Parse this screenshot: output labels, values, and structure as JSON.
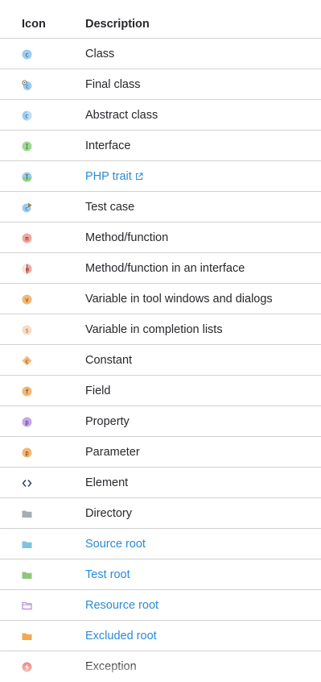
{
  "header": {
    "icon": "Icon",
    "description": "Description"
  },
  "rows": [
    {
      "icon": "class-icon",
      "text": "Class",
      "link": false
    },
    {
      "icon": "final-class-icon",
      "text": "Final class",
      "link": false
    },
    {
      "icon": "abstract-class-icon",
      "text": "Abstract class",
      "link": false
    },
    {
      "icon": "interface-icon",
      "text": "Interface",
      "link": false
    },
    {
      "icon": "php-trait-icon",
      "text": "PHP trait",
      "link": true
    },
    {
      "icon": "test-case-icon",
      "text": "Test case",
      "link": false
    },
    {
      "icon": "method-icon",
      "text": "Method/function",
      "link": false
    },
    {
      "icon": "interface-method-icon",
      "text": "Method/function in an interface",
      "link": false
    },
    {
      "icon": "variable-icon",
      "text": "Variable in tool windows and dialogs",
      "link": false
    },
    {
      "icon": "completion-variable-icon",
      "text": "Variable in completion lists",
      "link": false
    },
    {
      "icon": "constant-icon",
      "text": "Constant",
      "link": false
    },
    {
      "icon": "field-icon",
      "text": "Field",
      "link": false
    },
    {
      "icon": "property-icon",
      "text": "Property",
      "link": false
    },
    {
      "icon": "parameter-icon",
      "text": "Parameter",
      "link": false
    },
    {
      "icon": "element-icon",
      "text": "Element",
      "link": false
    },
    {
      "icon": "directory-icon",
      "text": "Directory",
      "link": false
    },
    {
      "icon": "source-root-icon",
      "text": "Source root",
      "link": true
    },
    {
      "icon": "test-root-icon",
      "text": "Test root",
      "link": true
    },
    {
      "icon": "resource-root-icon",
      "text": "Resource root",
      "link": true
    },
    {
      "icon": "excluded-root-icon",
      "text": "Excluded root",
      "link": true
    },
    {
      "icon": "exception-icon",
      "text": "Exception",
      "link": false
    }
  ],
  "colors": {
    "link": "#2a8bd8",
    "text": "#27282c",
    "divider": "#d1d1d2",
    "class_blue": "#9ccdf0",
    "interface_green": "#9ed993",
    "method_red": "#f0a8a0",
    "variable_orange": "#f3b774",
    "property_purple": "#c6a6e6",
    "folder_gray": "#a8adb3",
    "folder_blue": "#7ec3e6",
    "folder_green": "#8ec77d",
    "folder_purple": "#b58ad8",
    "folder_orange": "#f1a850"
  }
}
